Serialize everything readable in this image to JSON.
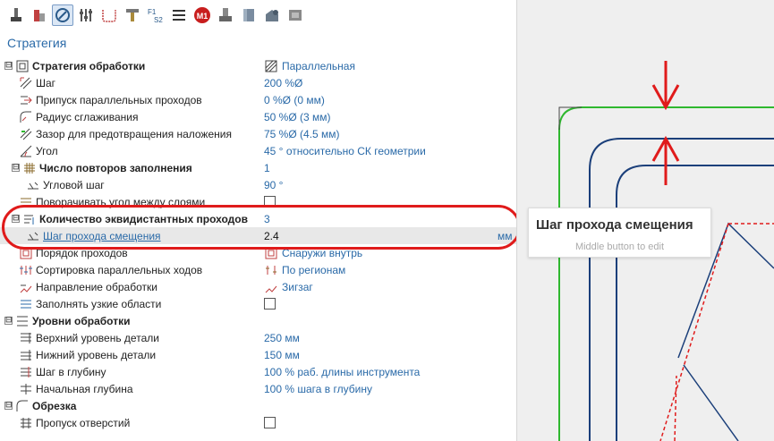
{
  "toolbar": {
    "icons": [
      "tool-icon",
      "stock-icon",
      "strategy-icon",
      "feeds-icon",
      "links-icon",
      "holder-icon",
      "operations-icon",
      "list-icon",
      "macro-icon",
      "simulation-icon",
      "model-icon",
      "transform-icon",
      "settings-icon"
    ],
    "macro_label": "M1",
    "f1_label": "F1",
    "s2_label": "S2"
  },
  "section_title": "Стратегия",
  "rows": [
    {
      "name": "Стратегия обработки",
      "value": "Параллельная"
    },
    {
      "name": "Шаг",
      "value": "200 %Ø"
    },
    {
      "name": "Припуск параллельных проходов",
      "value": "0 %Ø (0 мм)"
    },
    {
      "name": "Радиус сглаживания",
      "value": "50 %Ø (3 мм)"
    },
    {
      "name": "Зазор для предотвращения наложения",
      "value": "75 %Ø (4.5 мм)"
    },
    {
      "name": "Угол",
      "value": "45 ° относительно СК геометрии"
    },
    {
      "name": "Число повторов заполнения",
      "value": "1"
    },
    {
      "name": "Угловой шаг",
      "value": "90 °"
    },
    {
      "name": "Поворачивать угол между слоями",
      "value": ""
    },
    {
      "name": "Количество эквидистантных проходов",
      "value": "3"
    },
    {
      "name": "Шаг прохода смещения",
      "value": "2.4",
      "unit": "мм"
    },
    {
      "name": "Порядок проходов",
      "value": "Снаружи внутрь"
    },
    {
      "name": "Сортировка параллельных ходов",
      "value": "По регионам"
    },
    {
      "name": "Направление обработки",
      "value": "Зигзаг"
    },
    {
      "name": "Заполнять узкие области",
      "value": ""
    },
    {
      "name": "Уровни обработки",
      "value": ""
    },
    {
      "name": "Верхний уровень детали",
      "value": "250 мм"
    },
    {
      "name": "Нижний уровень детали",
      "value": "150 мм"
    },
    {
      "name": "Шаг в глубину",
      "value": "100 % раб. длины инструмента"
    },
    {
      "name": "Начальная глубина",
      "value": "100 % шага в глубину"
    },
    {
      "name": "Обрезка",
      "value": ""
    },
    {
      "name": "Пропуск отверстий",
      "value": ""
    }
  ],
  "expanders": {
    "collapse": "⊟"
  },
  "tooltip": {
    "title": "Шаг прохода смещения",
    "hint": "Middle button to edit"
  },
  "colors": {
    "accent_text": "#2a6aa8",
    "highlight_ellipse": "#e01b1b",
    "stock_outline": "#2fb82f",
    "toolpath": "#1b3f7a",
    "dimension_arrow": "#e01b1b"
  }
}
